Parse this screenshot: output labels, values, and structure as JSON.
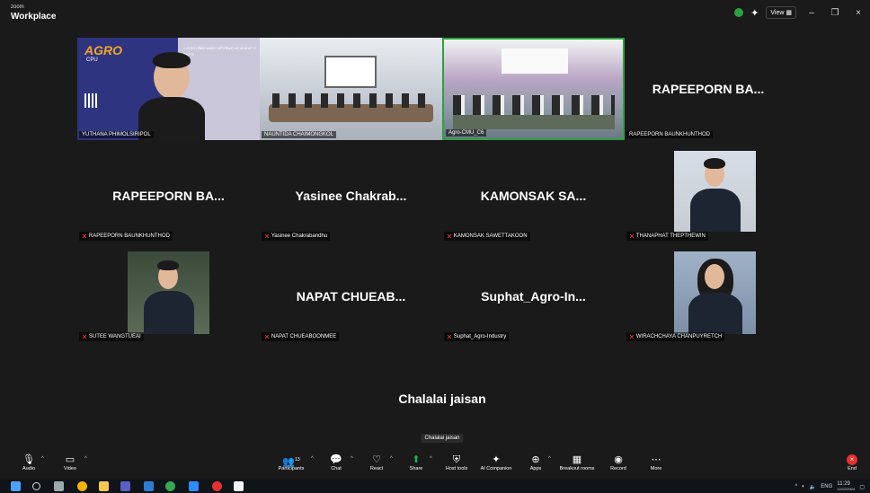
{
  "titlebar": {
    "brand_small": "zoom",
    "brand_big": "Workplace",
    "view_label": "View",
    "minimize": "–",
    "restore": "❐",
    "close": "×"
  },
  "slide": {
    "logo": "AGRO",
    "sub": "CPU",
    "header": "1 AGRO ติดตามผลการดำเนินงานตามแผนการจัดการ"
  },
  "tiles": {
    "t1": "YUTHANA PHIMOLSIRIPOL",
    "t2": "NAUNTIDA CHAIMONGKOL",
    "t3": "Agro-CMU_C6",
    "t4_big": "RAPEEPORN BA...",
    "t4": "RAPEEPORN BAUNKHUNTHOD",
    "t5_big": "RAPEEPORN BA...",
    "t5": "RAPEEPORN BAUNKHUNTHOD",
    "t6_big": "Yasinee Chakrab...",
    "t6": "Yasinee Chakrabandhu",
    "t7_big": "KAMONSAK SA...",
    "t7": "KAMONSAK SAWETTAKOON",
    "t8": "THANAPHAT THEPTHEWIN",
    "t9": "SUTEE WANGTUEAI",
    "t10_big": "NAPAT CHUEAB...",
    "t10": "NAPAT CHUEABOONMEE",
    "t11_big": "Suphat_Agro-In...",
    "t11": "Suphat_Agro-Industry",
    "t12": "WIRACHCHAYA CHANPUYRETCH",
    "t13_big": "Chalalai jaisan",
    "t13": "Chalalai jaisan"
  },
  "toolbar": {
    "audio": "Audio",
    "video": "Video",
    "participants": "Participants",
    "participants_count": "13",
    "chat": "Chat",
    "react": "React",
    "share": "Share",
    "host_tools": "Host tools",
    "ai_companion": "AI Companion",
    "apps": "Apps",
    "breakout": "Breakout rooms",
    "record": "Record",
    "more": "More",
    "end": "End"
  },
  "taskbar": {
    "lang": "ENG",
    "time": "11:29",
    "date": "12/12/2024"
  },
  "colors": {
    "background": "#1a1a1a",
    "active_border": "#2ea043",
    "mic_off": "#e5322d",
    "share_green": "#22b14c"
  }
}
